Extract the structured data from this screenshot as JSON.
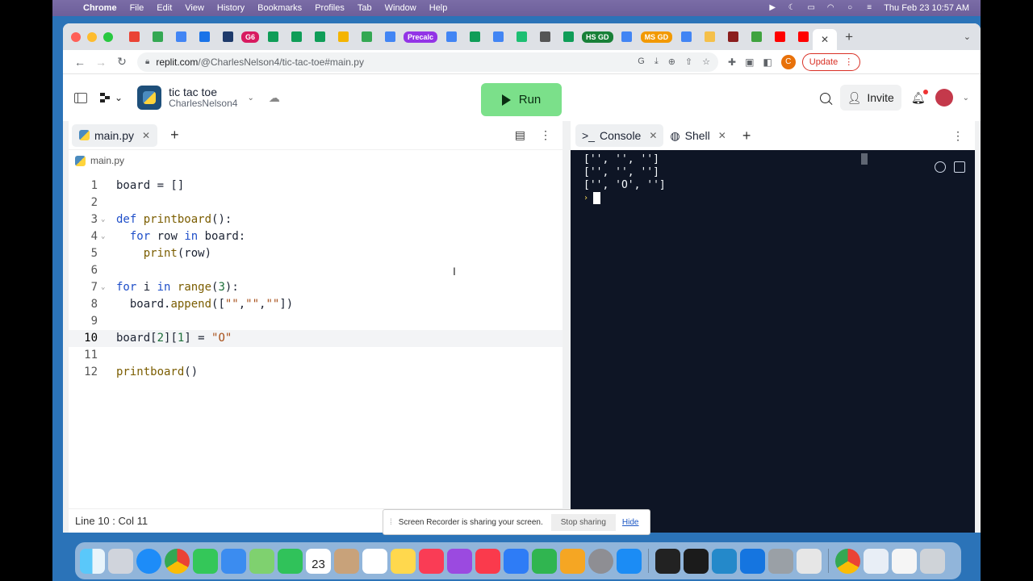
{
  "menubar": {
    "app": "Chrome",
    "items": [
      "File",
      "Edit",
      "View",
      "History",
      "Bookmarks",
      "Profiles",
      "Tab",
      "Window",
      "Help"
    ],
    "datetime": "Thu Feb 23  10:57 AM"
  },
  "browser": {
    "bookmark_pills": [
      {
        "label": "G6",
        "color": "#d81b60"
      },
      {
        "label": "Precalc",
        "color": "#9334e6"
      },
      {
        "label": "HS GD",
        "color": "#188038"
      },
      {
        "label": "MS GD",
        "color": "#f29900"
      }
    ],
    "url_host": "replit.com",
    "url_path": "/@CharlesNelson4/tic-tac-toe#main.py",
    "profile_initial": "C",
    "update_label": "Update"
  },
  "replit": {
    "repl_title": "tic tac toe",
    "repl_owner": "CharlesNelson4",
    "run_label": "Run",
    "invite_label": "Invite",
    "run_color": "#7be08a"
  },
  "editor": {
    "tab_label": "main.py",
    "breadcrumb": "main.py",
    "status": "Line 10 : Col 11",
    "line_numbers": [
      "1",
      "2",
      "3",
      "4",
      "5",
      "6",
      "7",
      "8",
      "9",
      "10",
      "11",
      "12"
    ]
  },
  "console": {
    "tabs": [
      "Console",
      "Shell"
    ],
    "output": [
      "['', '', '']",
      "['', '', '']",
      "['', 'O', '']"
    ]
  },
  "recorder": {
    "message": "Screen Recorder is sharing your screen.",
    "stop_label": "Stop sharing",
    "hide_label": "Hide"
  },
  "dock": {
    "icons": [
      "finder-icon",
      "launchpad-icon",
      "safari-icon",
      "chrome-icon",
      "messages-icon",
      "mail-icon",
      "maps-icon",
      "facetime-icon",
      "calendar-icon",
      "contacts-icon",
      "reminders-icon",
      "notes-icon",
      "music-icon",
      "podcasts-icon",
      "news-icon",
      "keynote-icon",
      "numbers-icon",
      "pages-icon",
      "system-preferences-icon",
      "app-store-icon",
      "terminal-icon",
      "activity-monitor-icon",
      "vscode-icon",
      "xcode-icon",
      "automator-icon",
      "bbedit-icon",
      "chrome-alt-icon",
      "preview-icon",
      "textedit-icon",
      "trash-icon"
    ],
    "calendar_day": "23"
  }
}
